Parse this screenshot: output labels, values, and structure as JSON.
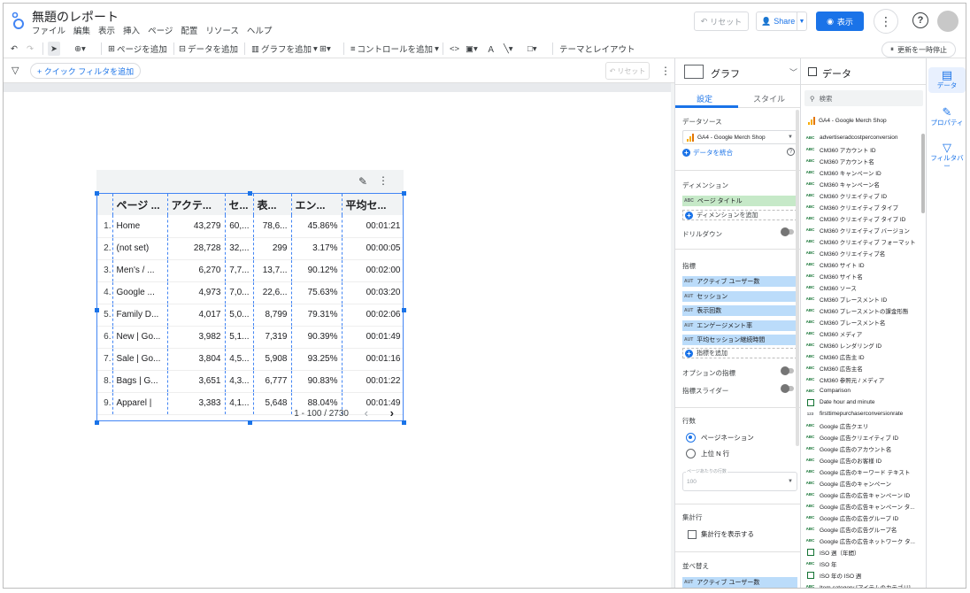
{
  "header": {
    "title": "無題のレポート",
    "menus": [
      "ファイル",
      "編集",
      "表示",
      "挿入",
      "ページ",
      "配置",
      "リソース",
      "ヘルプ"
    ],
    "reset_label": "リセット",
    "share_label": "Share",
    "view_label": "表示"
  },
  "toolbar": {
    "add_page": "ページを追加",
    "add_data": "データを追加",
    "add_chart": "グラフを追加",
    "add_control": "コントロールを追加",
    "theme_layout": "テーマとレイアウト",
    "pause_update": "更新を一時停止"
  },
  "filterbar": {
    "quick_filter": "+ クイック フィルタを追加",
    "reset_label": "リセット"
  },
  "table": {
    "headers": [
      "ページ ...",
      "アクテ...",
      "セ...",
      "表...",
      "エン...",
      "平均セ..."
    ],
    "rows": [
      {
        "idx": "1.",
        "page": "Home",
        "active": "43,279",
        "sessions": "60,...",
        "views": "78,6...",
        "engage": "45.86%",
        "avg": "00:01:21"
      },
      {
        "idx": "2.",
        "page": "(not set)",
        "active": "28,728",
        "sessions": "32,...",
        "views": "299",
        "engage": "3.17%",
        "avg": "00:00:05"
      },
      {
        "idx": "3.",
        "page": "Men's / ...",
        "active": "6,270",
        "sessions": "7,7...",
        "views": "13,7...",
        "engage": "90.12%",
        "avg": "00:02:00"
      },
      {
        "idx": "4.",
        "page": "Google ...",
        "active": "4,973",
        "sessions": "7,0...",
        "views": "22,6...",
        "engage": "75.63%",
        "avg": "00:03:20"
      },
      {
        "idx": "5.",
        "page": "Family D...",
        "active": "4,017",
        "sessions": "5,0...",
        "views": "8,799",
        "engage": "79.31%",
        "avg": "00:02:06"
      },
      {
        "idx": "6.",
        "page": "New | Go...",
        "active": "3,982",
        "sessions": "5,1...",
        "views": "7,319",
        "engage": "90.39%",
        "avg": "00:01:49"
      },
      {
        "idx": "7.",
        "page": "Sale | Go...",
        "active": "3,804",
        "sessions": "4,5...",
        "views": "5,908",
        "engage": "93.25%",
        "avg": "00:01:16"
      },
      {
        "idx": "8.",
        "page": "Bags | G...",
        "active": "3,651",
        "sessions": "4,3...",
        "views": "6,777",
        "engage": "90.83%",
        "avg": "00:01:22"
      },
      {
        "idx": "9.",
        "page": "Apparel |",
        "active": "3,383",
        "sessions": "4,1...",
        "views": "5,648",
        "engage": "88.04%",
        "avg": "00:01:49"
      }
    ],
    "pagination": "1 - 100 / 2730"
  },
  "props": {
    "title": "グラフ",
    "tab_setup": "設定",
    "tab_style": "スタイル",
    "datasource_label": "データソース",
    "datasource_value": "GA4 - Google Merch Shop",
    "blend_label": "データを統合",
    "dimension_label": "ディメンション",
    "dimension_chip": "ページ タイトル",
    "add_dimension": "ディメンションを追加",
    "drilldown_label": "ドリルダウン",
    "metric_label": "指標",
    "metrics": [
      "アクティブ ユーザー数",
      "セッション",
      "表示回数",
      "エンゲージメント率",
      "平均セッション継続時間"
    ],
    "add_metric": "指標を追加",
    "optional_metrics": "オプションの指標",
    "metric_slider": "指標スライダー",
    "rows_label": "行数",
    "pagination_option": "ページネーション",
    "topn_option": "上位 N 行",
    "rows_per_page_label": "ページあたりの行数",
    "rows_per_page_value": "100",
    "summary_label": "集計行",
    "summary_checkbox": "集計行を表示する",
    "sort_label": "並べ替え",
    "sort_chip": "アクティブ ユーザー数",
    "badge_dim": "ABC",
    "badge_met": "AUT"
  },
  "data": {
    "title": "データ",
    "search_placeholder": "検索",
    "source": "GA4 - Google Merch Shop",
    "fields": [
      {
        "type": "ABC",
        "name": "advertiseradcostperconversion"
      },
      {
        "type": "ABC",
        "name": "CM360 アカウント ID"
      },
      {
        "type": "ABC",
        "name": "CM360 アカウント名"
      },
      {
        "type": "ABC",
        "name": "CM360 キャンペーン ID"
      },
      {
        "type": "ABC",
        "name": "CM360 キャンペーン名"
      },
      {
        "type": "ABC",
        "name": "CM360 クリエイティブ ID"
      },
      {
        "type": "ABC",
        "name": "CM360 クリエイティブ タイプ"
      },
      {
        "type": "ABC",
        "name": "CM360 クリエイティブ タイプ ID"
      },
      {
        "type": "ABC",
        "name": "CM360 クリエイティブ バージョン"
      },
      {
        "type": "ABC",
        "name": "CM360 クリエイティブ フォーマット"
      },
      {
        "type": "ABC",
        "name": "CM360 クリエイティブ名"
      },
      {
        "type": "ABC",
        "name": "CM360 サイト ID"
      },
      {
        "type": "ABC",
        "name": "CM360 サイト名"
      },
      {
        "type": "ABC",
        "name": "CM360 ソース"
      },
      {
        "type": "ABC",
        "name": "CM360 プレースメント ID"
      },
      {
        "type": "ABC",
        "name": "CM360 プレースメントの課金形態"
      },
      {
        "type": "ABC",
        "name": "CM360 プレースメント名"
      },
      {
        "type": "ABC",
        "name": "CM360 メディア"
      },
      {
        "type": "ABC",
        "name": "CM360 レンダリング ID"
      },
      {
        "type": "ABC",
        "name": "CM360 広告主 ID"
      },
      {
        "type": "ABC",
        "name": "CM360 広告主名"
      },
      {
        "type": "ABC",
        "name": "CM360 参照元 / メディア"
      },
      {
        "type": "ABC",
        "name": "Comparison"
      },
      {
        "type": "CAL",
        "name": "Date hour and minute"
      },
      {
        "type": "123",
        "name": "firsttimepurchaserconversionrate"
      },
      {
        "type": "ABC",
        "name": "Google 広告クエリ"
      },
      {
        "type": "ABC",
        "name": "Google 広告クリエイティブ ID"
      },
      {
        "type": "ABC",
        "name": "Google 広告のアカウント名"
      },
      {
        "type": "ABC",
        "name": "Google 広告のお客様 ID"
      },
      {
        "type": "ABC",
        "name": "Google 広告のキーワード テキスト"
      },
      {
        "type": "ABC",
        "name": "Google 広告のキャンペーン"
      },
      {
        "type": "ABC",
        "name": "Google 広告の広告キャンペーン ID"
      },
      {
        "type": "ABC",
        "name": "Google 広告の広告キャンペーン タ..."
      },
      {
        "type": "ABC",
        "name": "Google 広告の広告グループ ID"
      },
      {
        "type": "ABC",
        "name": "Google 広告の広告グループ名"
      },
      {
        "type": "ABC",
        "name": "Google 広告の広告ネットワーク タ..."
      },
      {
        "type": "CAL",
        "name": "ISO 週（年間）"
      },
      {
        "type": "ABC",
        "name": "ISO 年"
      },
      {
        "type": "CAL",
        "name": "ISO 年の ISO 週"
      },
      {
        "type": "ABC",
        "name": "Item category [アイテムのカテゴリ]"
      }
    ]
  },
  "rail": {
    "data": "データ",
    "properties": "プロパティ",
    "filter": "フィルタバー"
  },
  "colors": {
    "accent": "#1a73e8",
    "dimension_chip": "#c6e9c8",
    "metric_chip": "#bbdcfa"
  }
}
